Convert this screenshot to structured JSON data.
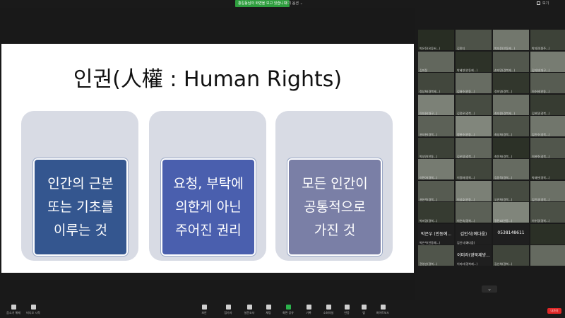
{
  "topbar": {
    "share_notice": "홍길동님의 화면을 보고 있습니다",
    "view_options": "보기 옵션 ⌄",
    "fullscreen": "보기"
  },
  "slide": {
    "title": "인권(人權 : Human Rights)",
    "cards": [
      {
        "lines": [
          "인간의 근본",
          "또는 기초를",
          "이루는 것"
        ]
      },
      {
        "lines": [
          "요청, 부탁에",
          "의한게 아닌",
          "주어진 권리"
        ]
      },
      {
        "lines": [
          "모든 인간이",
          "공통적으로",
          "가진 것"
        ]
      }
    ]
  },
  "gallery": {
    "tiles": [
      {
        "name": "박은진(유튜버...)",
        "big": ""
      },
      {
        "name": "김민지",
        "big": ""
      },
      {
        "name": "박지윤(안동제...)",
        "big": ""
      },
      {
        "name": "박지민(원주...)",
        "big": ""
      },
      {
        "name": "김미정",
        "big": ""
      },
      {
        "name": "박혜영(안동제...)",
        "big": ""
      },
      {
        "name": "손지민(경북제...)",
        "big": ""
      },
      {
        "name": "김지현(대구...)",
        "big": ""
      },
      {
        "name": "정상희(경북제...)",
        "big": ""
      },
      {
        "name": "김태수(안동...)",
        "big": ""
      },
      {
        "name": "정미영(경북...)",
        "big": ""
      },
      {
        "name": "이수현(안동...)",
        "big": ""
      },
      {
        "name": "이지은(대구...)",
        "big": ""
      },
      {
        "name": "김정은(경북...)",
        "big": ""
      },
      {
        "name": "최지원(경북제...)",
        "big": ""
      },
      {
        "name": "김현정(경북...)",
        "big": ""
      },
      {
        "name": "권지현(경북...)",
        "big": ""
      },
      {
        "name": "정현수(안동...)",
        "big": ""
      },
      {
        "name": "최성희(경북...)",
        "big": ""
      },
      {
        "name": "김민수(경북...)",
        "big": ""
      },
      {
        "name": "박성민(안동...)",
        "big": ""
      },
      {
        "name": "김은정(경북...)",
        "big": ""
      },
      {
        "name": "최윤희(경북...)",
        "big": ""
      },
      {
        "name": "이현주(경북...)",
        "big": ""
      },
      {
        "name": "이민아(경북...)",
        "big": ""
      },
      {
        "name": "이정화(경북...)",
        "big": ""
      },
      {
        "name": "김동욱(경북...)",
        "big": ""
      },
      {
        "name": "박재현(경북...)",
        "big": ""
      },
      {
        "name": "권은주(경북...)",
        "big": ""
      },
      {
        "name": "이성호(안동...)",
        "big": ""
      },
      {
        "name": "오연희(경북...)",
        "big": ""
      },
      {
        "name": "김진영(경북...)",
        "big": ""
      },
      {
        "name": "박미경(경북...)",
        "big": ""
      },
      {
        "name": "이은숙(경북...)",
        "big": ""
      },
      {
        "name": "정민호(안동...)",
        "big": ""
      },
      {
        "name": "이수정(경북...)",
        "big": ""
      },
      {
        "name": "박은우(안동예...)",
        "big": "박은우 (안동예..."
      },
      {
        "name": "김인식(예다움)",
        "big": "김인식(예다움)"
      },
      {
        "name": "",
        "big": "0538148611"
      },
      {
        "name": "",
        "big": ""
      },
      {
        "name": "권영순(경북...)",
        "big": ""
      },
      {
        "name": "이미라(경북제...)",
        "big": "이미라(경북제방..."
      },
      {
        "name": "김선희(경북...)",
        "big": ""
      },
      {
        "name": "",
        "big": ""
      }
    ],
    "more_label": "⌄"
  },
  "toolbar": {
    "items": [
      {
        "label": "음소거 해제",
        "icon": "mic-icon"
      },
      {
        "label": "비디오 시작",
        "icon": "video-icon"
      },
      {
        "label": "보안",
        "icon": "shield-icon"
      },
      {
        "label": "참가자",
        "icon": "participants-icon"
      },
      {
        "label": "설문조사",
        "icon": "poll-icon"
      },
      {
        "label": "채팅",
        "icon": "chat-icon"
      },
      {
        "label": "화면 공유",
        "icon": "share-screen-icon"
      },
      {
        "label": "기록",
        "icon": "record-icon"
      },
      {
        "label": "소회의실",
        "icon": "breakout-icon"
      },
      {
        "label": "반응",
        "icon": "reactions-icon"
      },
      {
        "label": "앱",
        "icon": "apps-icon"
      },
      {
        "label": "화이트보드",
        "icon": "whiteboard-icon"
      }
    ],
    "end_label": "나가기"
  },
  "colors": {
    "card_1": "#34568f",
    "card_2": "#4a5fae",
    "card_3": "#7a7fa6",
    "share_green": "#2e9e3e",
    "end_red": "#e02828"
  }
}
